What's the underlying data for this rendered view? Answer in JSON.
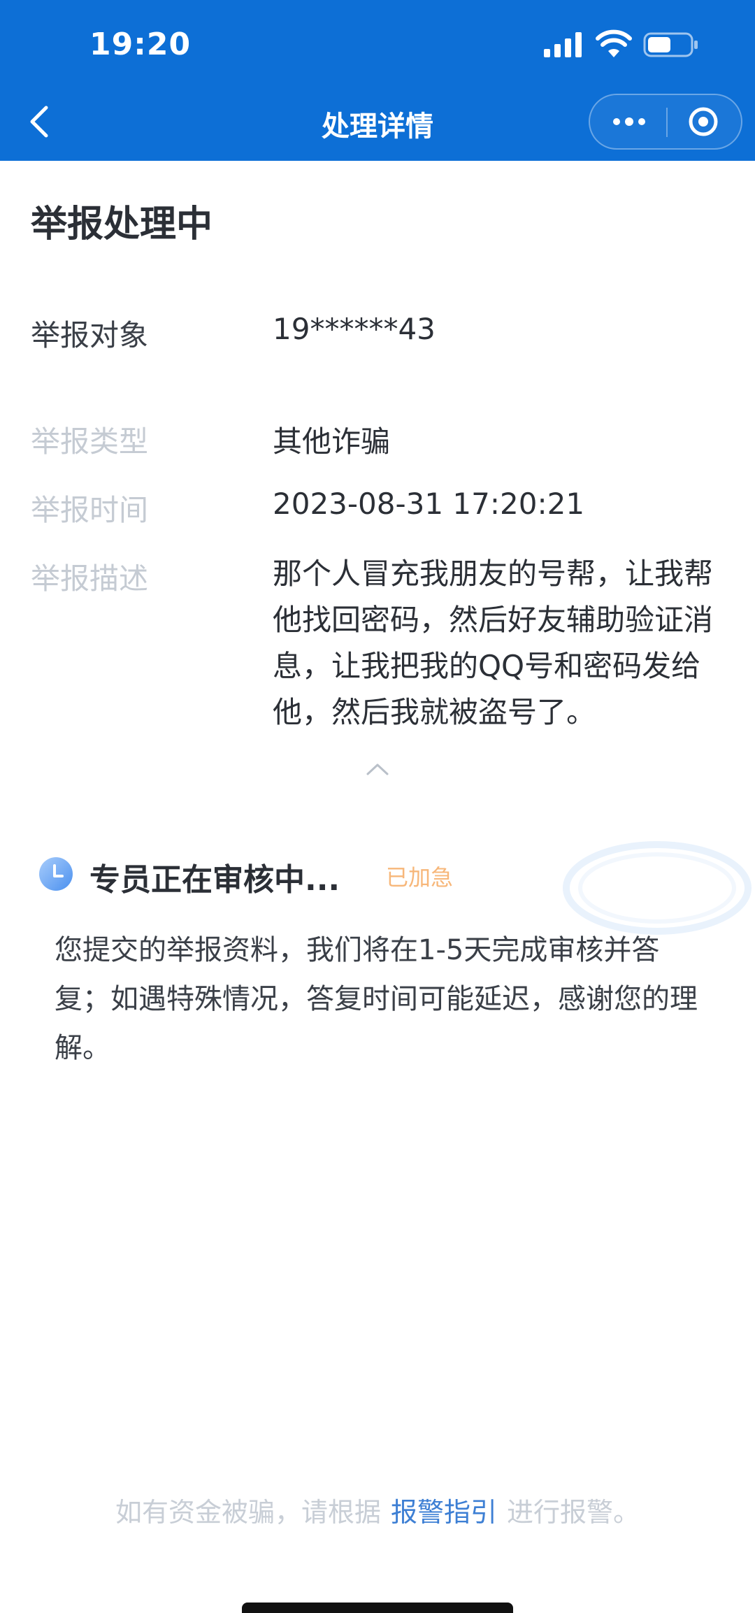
{
  "status_bar": {
    "time": "19:20"
  },
  "nav": {
    "title": "处理详情"
  },
  "report": {
    "status_title": "举报处理中",
    "target_label": "举报对象",
    "target_value": "19******43",
    "type_label": "举报类型",
    "type_value": "其他诈骗",
    "time_label": "举报时间",
    "time_value": "2023-08-31 17:20:21",
    "desc_label": "举报描述",
    "desc_value": "那个人冒充我朋友的号帮，让我帮他找回密码，然后好友辅助验证消息，让我把我的QQ号和密码发给他，然后我就被盗号了。"
  },
  "review": {
    "title": "专员正在审核中...",
    "badge": "已加急",
    "text": "您提交的举报资料，我们将在1-5天完成审核并答复；如遇特殊情况，答复时间可能延迟，感谢您的理解。"
  },
  "footer": {
    "prefix": "如有资金被骗，请根据",
    "link": "报警指引",
    "suffix": "进行报警。"
  },
  "colors": {
    "header_bg": "#0d6fd6",
    "link": "#3d7fd4",
    "badge": "#f7b77a",
    "label_light": "#c5cbd3"
  },
  "icons": [
    "back-arrow-icon",
    "more-icon",
    "target-icon",
    "collapse-up-icon",
    "clock-icon",
    "signal-icon",
    "wifi-icon",
    "battery-icon"
  ]
}
